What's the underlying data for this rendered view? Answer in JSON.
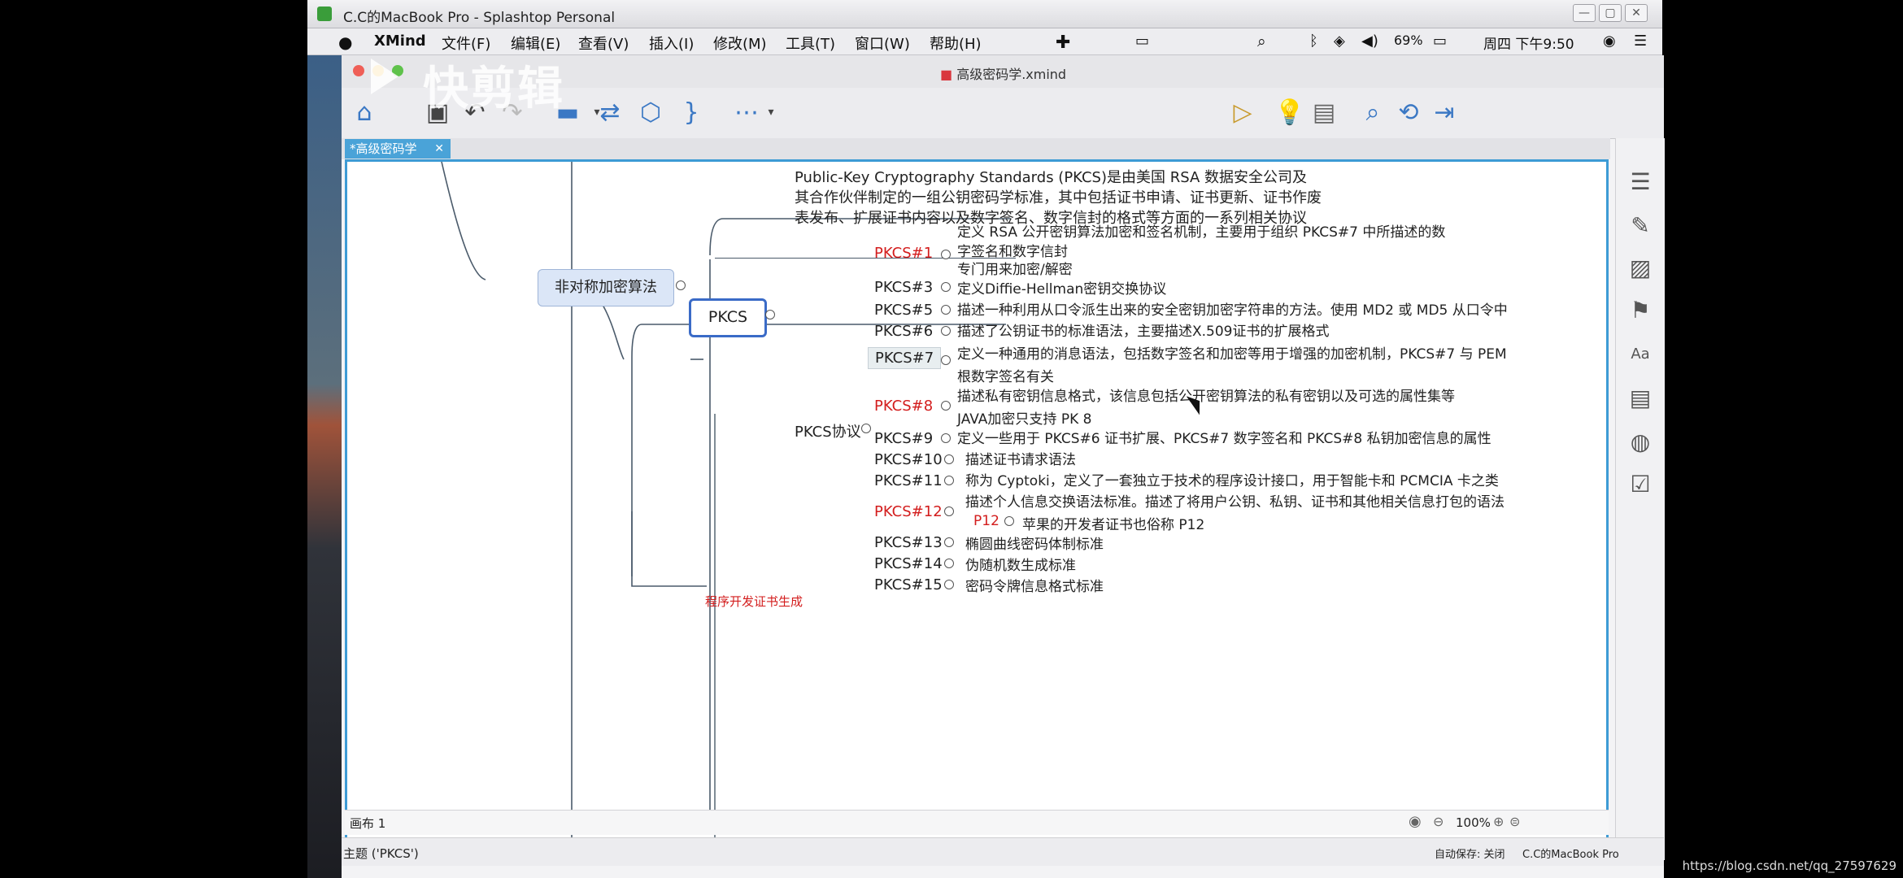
{
  "splashtop": {
    "title": "C.C的MacBook Pro - Splashtop Personal",
    "min": "—",
    "max": "▢",
    "close": "✕"
  },
  "menubar": {
    "apple": "",
    "items": [
      "XMind",
      "文件(F)",
      "编辑(E)",
      "查看(V)",
      "插入(I)",
      "修改(M)",
      "工具(T)",
      "窗口(W)",
      "帮助(H)"
    ],
    "battery": "69%",
    "clock": "周四 下午9:50"
  },
  "watermark": "快剪辑",
  "xmind": {
    "file_title": "高级密码学.xmind",
    "tab_label": "*高级密码学",
    "sheet_label": "画布 1",
    "zoom": "100%",
    "status_left": "主题 ('PKCS')",
    "autosave": "自动保存: 关闭",
    "user": "C.C的MacBook Pro"
  },
  "mindmap": {
    "parent_topic": "非对称加密算法",
    "central": "PKCS",
    "pkcs_note": [
      "Public-Key Cryptography Standards (PKCS)是由美国 RSA 数据安全公司及",
      "其合作伙伴制定的一组公钥密码学标准，其中包括证书申请、证书更新、证书作废",
      "表发布、扩展证书内容以及数字签名、数字信封的格式等方面的一系列相关协议"
    ],
    "protocol_label": "PKCS协议",
    "p1": "PKCS#1",
    "p1_desc1": "定义 RSA 公开密钥算法加密和签名机制，主要用于组织 PKCS#7 中所描述的数",
    "p1_desc2": "字签名和数字信封",
    "p1_desc3": "专门用来加密/解密",
    "p3": "PKCS#3",
    "p3_desc": "定义Diffie-Hellman密钥交换协议",
    "p5": "PKCS#5",
    "p5_desc": "描述一种利用从口令派生出来的安全密钥加密字符串的方法。使用 MD2 或 MD5 从口令中",
    "p6": "PKCS#6",
    "p6_desc": "描述了公钥证书的标准语法，主要描述X.509证书的扩展格式",
    "p7": "PKCS#7",
    "p7_desc1": "定义一种通用的消息语法，包括数字签名和加密等用于增强的加密机制，PKCS#7 与 PEM",
    "p7_desc2": "根数字签名有关",
    "p8": "PKCS#8",
    "p8_desc1": "描述私有密钥信息格式，该信息包括公开密钥算法的私有密钥以及可选的属性集等",
    "p8_desc2": "JAVA加密只支持 PK 8",
    "p9": "PKCS#9",
    "p9_desc": "定义一些用于 PKCS#6 证书扩展、PKCS#7 数字签名和 PKCS#8 私钥加密信息的属性",
    "p10": "PKCS#10",
    "p10_desc": "描述证书请求语法",
    "p11": "PKCS#11",
    "p11_desc": "称为 Cyptoki，定义了一套独立于技术的程序设计接口，用于智能卡和 PCMCIA 卡之类",
    "p12": "PKCS#12",
    "p12_desc": "描述个人信息交换语法标准。描述了将用户公钥、私钥、证书和其他相关信息打包的语法",
    "p12_sub": "P12",
    "p12_sub_desc": "苹果的开发者证书也俗称 P12",
    "p13": "PKCS#13",
    "p13_desc": "椭圆曲线密码体制标准",
    "p14": "PKCS#14",
    "p14_desc": "伪随机数生成标准",
    "p15": "PKCS#15",
    "p15_desc": "密码令牌信息格式标准",
    "cut_bottom": "程序开发证书生成"
  },
  "url": "https://blog.csdn.net/qq_27597629"
}
